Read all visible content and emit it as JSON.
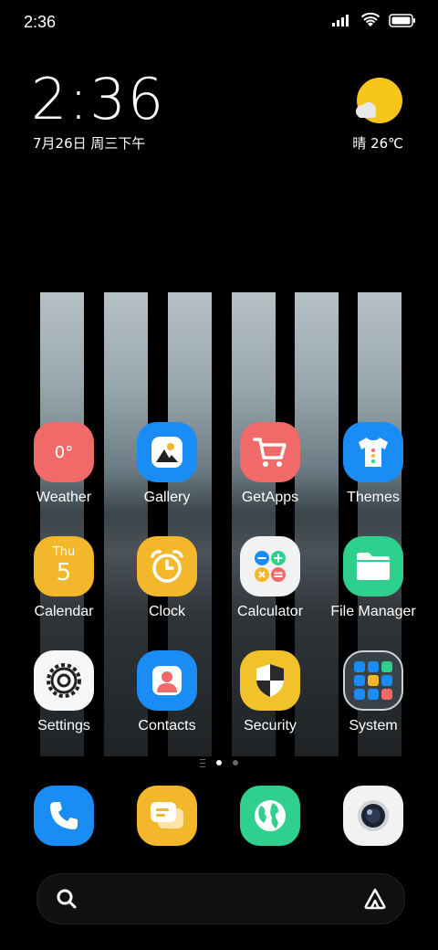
{
  "statusbar": {
    "time": "2:36"
  },
  "widget": {
    "time": "2:36",
    "date": "7月26日 周三下午",
    "weather": "晴 26℃"
  },
  "apps": {
    "weather": {
      "label": "Weather",
      "icon_text": "0°"
    },
    "gallery": {
      "label": "Gallery"
    },
    "getapps": {
      "label": "GetApps"
    },
    "themes": {
      "label": "Themes"
    },
    "calendar": {
      "label": "Calendar",
      "day": "Thu",
      "date": "5"
    },
    "clock": {
      "label": "Clock"
    },
    "calculator": {
      "label": "Calculator"
    },
    "filemanager": {
      "label": "File Manager"
    },
    "settings": {
      "label": "Settings"
    },
    "contacts": {
      "label": "Contacts"
    },
    "security": {
      "label": "Security"
    },
    "system": {
      "label": "System"
    }
  },
  "colors": {
    "weather": "#f06a6a",
    "gallery": "#1a8cf5",
    "getapps": "#f06a6a",
    "themes": "#1a8cf5",
    "calendar": "#f2b72a",
    "clock": "#f2b72a",
    "calculator": "#f2f2f2",
    "filemanager": "#2fcf8e",
    "settings": "#f7f7f7",
    "contacts": "#1a8cf5",
    "security": "#f2c22a",
    "phone": "#1a8cf5",
    "messages": "#f2b72a",
    "browser": "#2fcf8e",
    "camera": "#f2f2f2"
  }
}
